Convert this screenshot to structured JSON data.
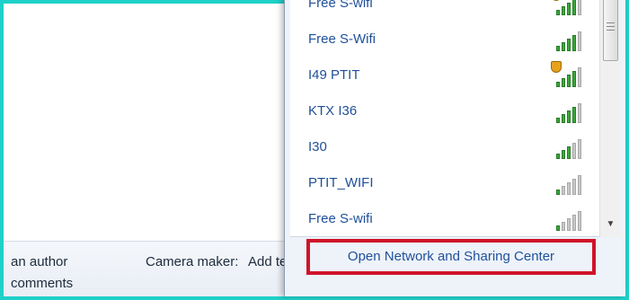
{
  "details": {
    "authors_value": "an author",
    "comments_value": "comments",
    "camera_maker_label": "Camera maker:",
    "camera_maker_value": "Add te"
  },
  "networks": [
    {
      "name": "Free S-wifi",
      "secured": true,
      "signal_bars": 4
    },
    {
      "name": "Free S-Wifi",
      "secured": false,
      "signal_bars": 4
    },
    {
      "name": "I49 PTIT",
      "secured": true,
      "signal_bars": 4
    },
    {
      "name": "KTX I36",
      "secured": false,
      "signal_bars": 4
    },
    {
      "name": "I30",
      "secured": false,
      "signal_bars": 3
    },
    {
      "name": "PTIT_WIFI",
      "secured": false,
      "signal_bars": 1
    },
    {
      "name": "Free S-wifi",
      "secured": false,
      "signal_bars": 1
    }
  ],
  "footer": {
    "open_center_label": "Open Network and Sharing Center"
  },
  "colors": {
    "highlight": "#d0132a",
    "link": "#1f4f99",
    "border_accent": "#1fd0c8"
  }
}
